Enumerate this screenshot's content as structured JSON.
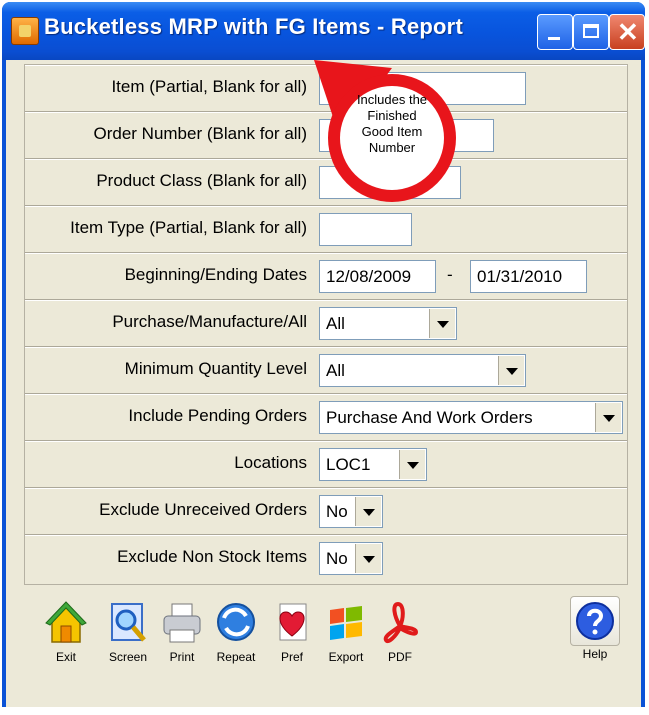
{
  "window": {
    "title": "Bucketless MRP with FG Items - Report",
    "close_glyph": "✕"
  },
  "form": {
    "item_label": "Item (Partial, Blank for all)",
    "item_value": "",
    "order_label": "Order Number (Blank for all)",
    "order_value": "",
    "product_class_label": "Product Class (Blank for all)",
    "product_class_value": "",
    "item_type_label": "Item Type (Partial, Blank for all)",
    "item_type_value": "",
    "dates_label": "Beginning/Ending Dates",
    "begin_date": "12/08/2009",
    "date_separator": "-",
    "end_date": "01/31/2010",
    "pma_label": "Purchase/Manufacture/All",
    "pma_value": "All",
    "min_qty_label": "Minimum Quantity Level",
    "min_qty_value": "All",
    "pending_label": "Include Pending Orders",
    "pending_value": "Purchase And Work Orders",
    "locations_label": "Locations",
    "locations_value": "LOC1",
    "exclude_unreceived_label": "Exclude Unreceived Orders",
    "exclude_unreceived_value": "No",
    "exclude_nonstock_label": "Exclude Non Stock Items",
    "exclude_nonstock_value": "No"
  },
  "callout": {
    "lines": [
      "Includes the",
      "Finished",
      "Good Item",
      "Number"
    ],
    "color": "#e8151b"
  },
  "toolbar": {
    "exit": "Exit",
    "screen": "Screen",
    "print": "Print",
    "repeat": "Repeat",
    "pref": "Pref",
    "export": "Export",
    "pdf": "PDF",
    "help": "Help",
    "icons": [
      "home-icon",
      "magnifier-icon",
      "printer-icon",
      "repeat-icon",
      "heart-document-icon",
      "windows-flag-icon",
      "pdf-icon",
      "help-icon"
    ]
  },
  "colors": {
    "titlebar": "#0a52d6",
    "client": "#ece9d8",
    "field_border": "#7f9db9"
  }
}
